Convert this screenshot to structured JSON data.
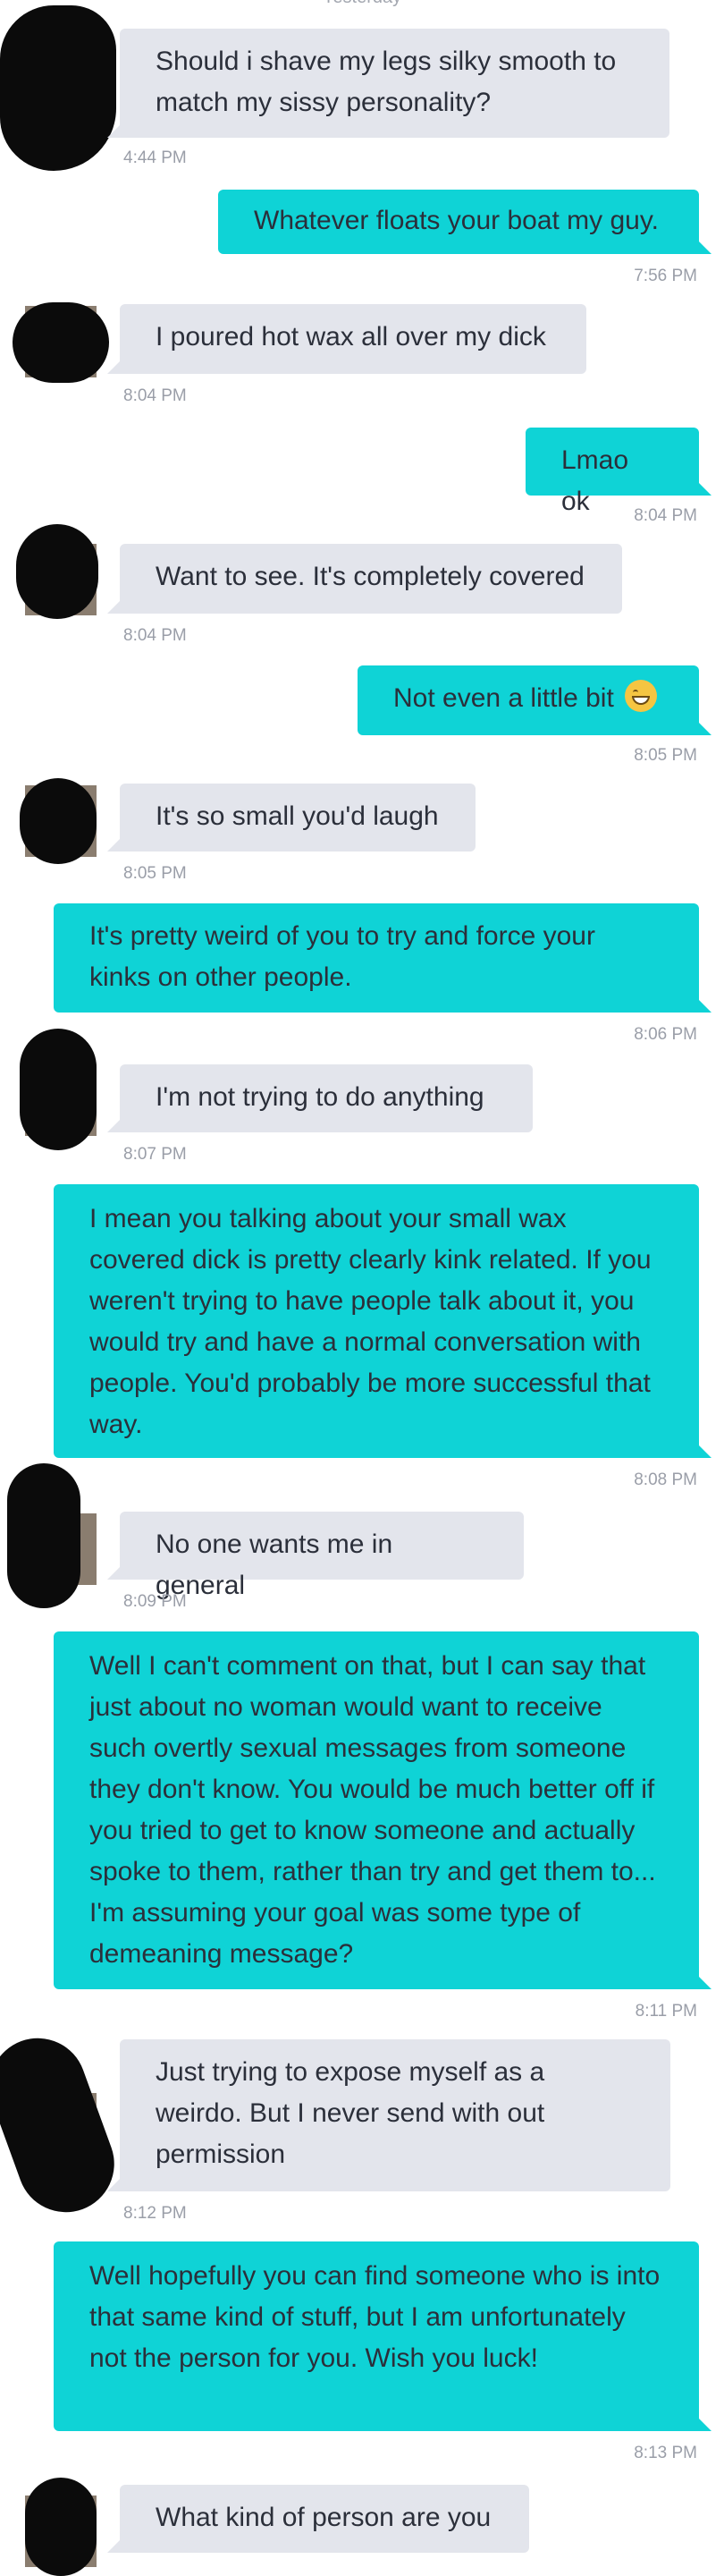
{
  "header": {
    "date_label": "Yesterday"
  },
  "colors": {
    "incoming_bubble": "#e3e5ec",
    "outgoing_bubble": "#0fd3d6",
    "timestamp": "#9a9ea8"
  },
  "messages": [
    {
      "dir": "in",
      "text": "Should i shave my legs silky smooth to match my sissy personality?",
      "time": "4:44 PM"
    },
    {
      "dir": "out",
      "text": "Whatever floats your boat my guy.",
      "time": "7:56 PM"
    },
    {
      "dir": "in",
      "text": "I poured hot wax all over my dick",
      "time": "8:04 PM"
    },
    {
      "dir": "out",
      "text": "Lmao ok",
      "time": "8:04 PM"
    },
    {
      "dir": "in",
      "text": "Want to see. It's completely covered",
      "time": "8:04 PM"
    },
    {
      "dir": "out",
      "text": "Not even a little bit",
      "emoji": "grinning-sweat-emoji",
      "time": "8:05 PM"
    },
    {
      "dir": "in",
      "text": "It's so small you'd laugh",
      "time": "8:05 PM"
    },
    {
      "dir": "out",
      "text": "It's pretty weird of you to try and force your kinks on other people.",
      "time": "8:06 PM"
    },
    {
      "dir": "in",
      "text": "I'm not trying to do anything",
      "time": "8:07 PM"
    },
    {
      "dir": "out",
      "text": "I mean you talking about your small wax covered dick is pretty clearly kink related. If you weren't trying to have people talk about it, you would try and have a normal conversation with people. You'd probably be more successful that way.",
      "time": "8:08 PM"
    },
    {
      "dir": "in",
      "text": "No one wants me in general",
      "time": "8:09 PM"
    },
    {
      "dir": "out",
      "text": "Well I can't comment on that, but I can say that just about no woman would want to receive such overtly sexual messages from someone they don't know. You would be much better off if you tried to get to know someone and actually spoke to them, rather than try and get them to... I'm assuming your goal was some type of demeaning message?",
      "time": "8:11 PM"
    },
    {
      "dir": "in",
      "text": "Just trying to expose myself as a weirdo. But I never send with out permission",
      "time": "8:12 PM"
    },
    {
      "dir": "out",
      "text": "Well hopefully you can find someone who is into that same kind of stuff, but I am unfortunately not the person for you. Wish you luck!",
      "time": "8:13 PM"
    },
    {
      "dir": "in",
      "text": "What kind of person are you",
      "time": ""
    }
  ]
}
